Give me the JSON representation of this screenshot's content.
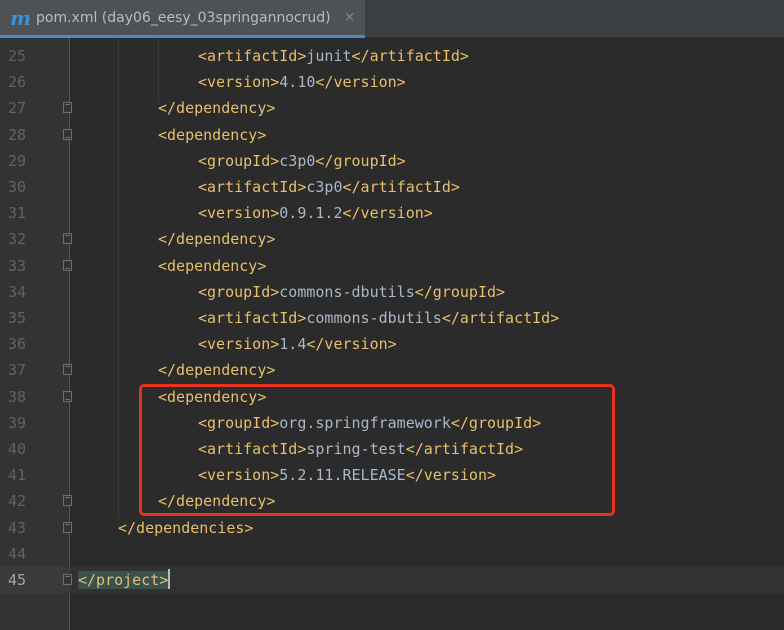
{
  "tab": {
    "icon": "m",
    "icon_name": "maven-icon",
    "title": "pom.xml (day06_eesy_03springannocrud)",
    "close_glyph": "×"
  },
  "editor": {
    "current_line": 45,
    "lines": [
      {
        "n": "25",
        "indent": 3,
        "open": "<artifactId>",
        "text": "junit",
        "close": "</artifactId>"
      },
      {
        "n": "26",
        "indent": 3,
        "open": "<version>",
        "text": "4.10",
        "close": "</version>"
      },
      {
        "n": "27",
        "indent": 2,
        "open": "</dependency>",
        "text": "",
        "close": ""
      },
      {
        "n": "28",
        "indent": 2,
        "open": "<dependency>",
        "text": "",
        "close": ""
      },
      {
        "n": "29",
        "indent": 3,
        "open": "<groupId>",
        "text": "c3p0",
        "close": "</groupId>"
      },
      {
        "n": "30",
        "indent": 3,
        "open": "<artifactId>",
        "text": "c3p0",
        "close": "</artifactId>"
      },
      {
        "n": "31",
        "indent": 3,
        "open": "<version>",
        "text": "0.9.1.2",
        "close": "</version>"
      },
      {
        "n": "32",
        "indent": 2,
        "open": "</dependency>",
        "text": "",
        "close": ""
      },
      {
        "n": "33",
        "indent": 2,
        "open": "<dependency>",
        "text": "",
        "close": ""
      },
      {
        "n": "34",
        "indent": 3,
        "open": "<groupId>",
        "text": "commons-dbutils",
        "close": "</groupId>"
      },
      {
        "n": "35",
        "indent": 3,
        "open": "<artifactId>",
        "text": "commons-dbutils",
        "close": "</artifactId>"
      },
      {
        "n": "36",
        "indent": 3,
        "open": "<version>",
        "text": "1.4",
        "close": "</version>"
      },
      {
        "n": "37",
        "indent": 2,
        "open": "</dependency>",
        "text": "",
        "close": ""
      },
      {
        "n": "38",
        "indent": 2,
        "open": "<dependency>",
        "text": "",
        "close": ""
      },
      {
        "n": "39",
        "indent": 3,
        "open": "<groupId>",
        "text": "org.springframework",
        "close": "</groupId>"
      },
      {
        "n": "40",
        "indent": 3,
        "open": "<artifactId>",
        "text": "spring-test",
        "close": "</artifactId>"
      },
      {
        "n": "41",
        "indent": 3,
        "open": "<version>",
        "text": "5.2.11.RELEASE",
        "close": "</version>"
      },
      {
        "n": "42",
        "indent": 2,
        "open": "</dependency>",
        "text": "",
        "close": ""
      },
      {
        "n": "43",
        "indent": 1,
        "open": "</dependencies>",
        "text": "",
        "close": ""
      },
      {
        "n": "44",
        "indent": 0,
        "open": "",
        "text": "",
        "close": ""
      },
      {
        "n": "45",
        "indent": 0,
        "open": "</project>",
        "text": "",
        "close": ""
      }
    ]
  },
  "colors": {
    "tag": "#e8bf6a",
    "text": "#a9b7c6",
    "annotation_box": "#e8311c"
  }
}
